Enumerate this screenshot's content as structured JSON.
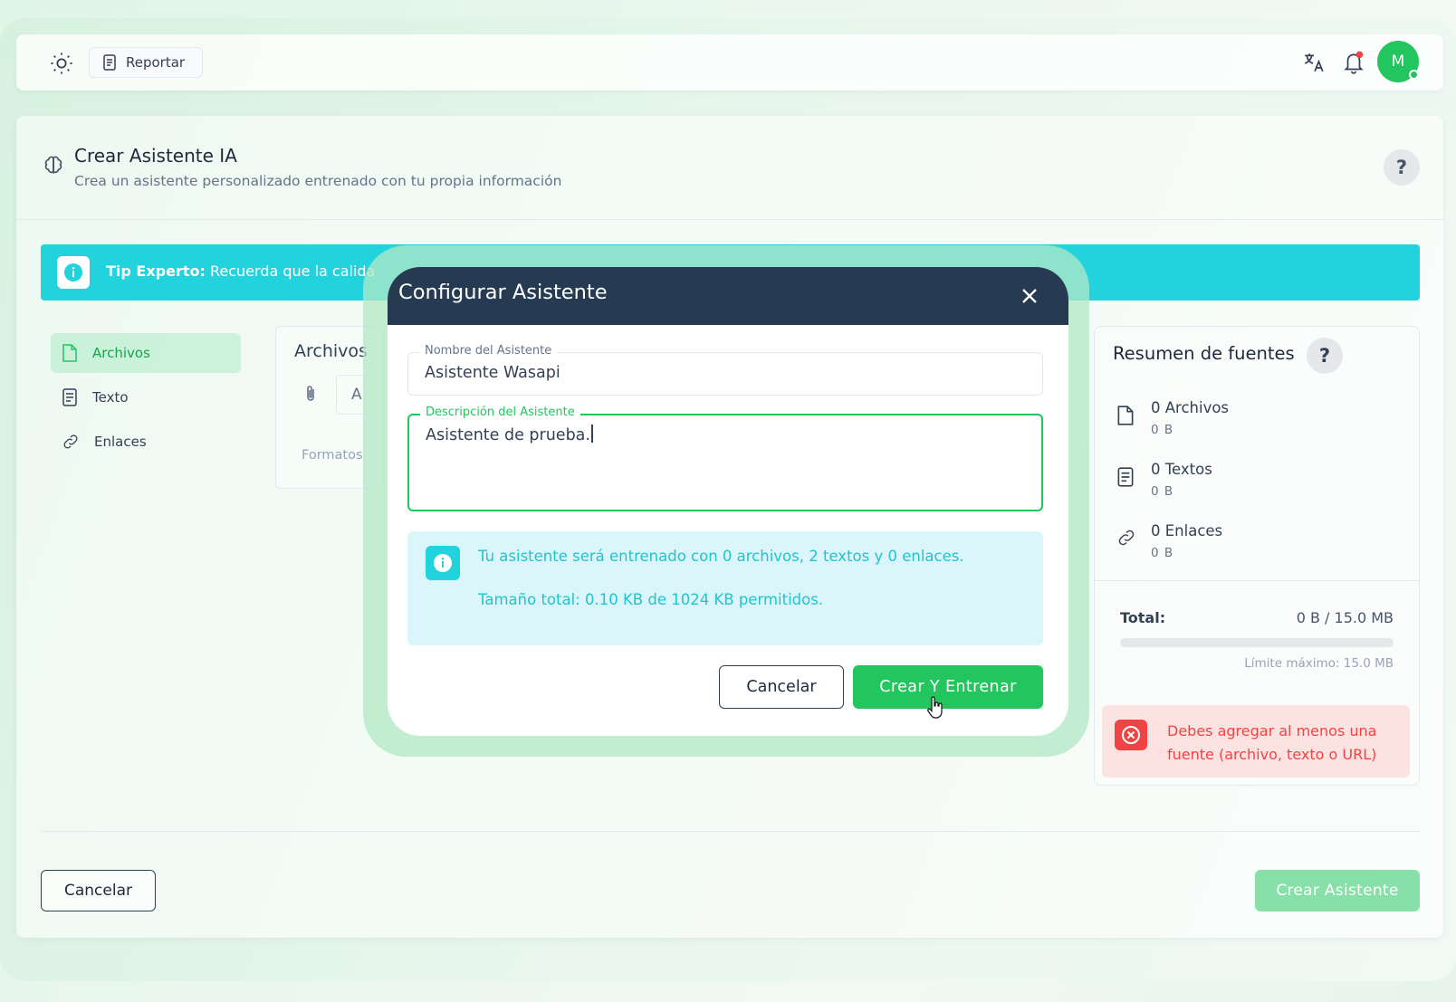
{
  "topbar": {
    "report_label": "Reportar",
    "avatar_initial": "M"
  },
  "page": {
    "title": "Crear Asistente IA",
    "subtitle": "Crea un asistente personalizado entrenado con tu propia información",
    "help_label": "?"
  },
  "tip": {
    "prefix": "Tip Experto:",
    "text": "Recuerda que la calida"
  },
  "sidebar": {
    "items": [
      {
        "label": "Archivos",
        "active": true
      },
      {
        "label": "Texto",
        "active": false
      },
      {
        "label": "Enlaces",
        "active": false
      }
    ]
  },
  "files_panel": {
    "title": "Archivos",
    "input_text": "A",
    "formats_text": "Formatos"
  },
  "summary": {
    "title": "Resumen de fuentes",
    "help_label": "?",
    "sources": [
      {
        "label": "0 Archivos",
        "size": "0 B",
        "icon": "file-icon"
      },
      {
        "label": "0 Textos",
        "size": "0 B",
        "icon": "text-doc-icon"
      },
      {
        "label": "0 Enlaces",
        "size": "0 B",
        "icon": "link-icon"
      }
    ],
    "total_label": "Total:",
    "total_value": "0 B / 15.0 MB",
    "progress_fraction": 0,
    "limit_text": "Límite máximo: 15.0 MB",
    "error_text": "Debes agregar al menos una fuente (archivo, texto o URL)"
  },
  "footer": {
    "cancel_label": "Cancelar",
    "create_label": "Crear Asistente"
  },
  "modal": {
    "title": "Configurar Asistente",
    "name_label": "Nombre del Asistente",
    "name_value": "Asistente Wasapi",
    "description_label": "Descripción del Asistente",
    "description_value": "Asistente de prueba.",
    "info_line1": "Tu asistente será entrenado con 0 archivos, 2 textos y 0 enlaces.",
    "info_line2": "Tamaño total: 0.10 KB de 1024 KB permitidos.",
    "cancel_label": "Cancelar",
    "create_label": "Crear Y Entrenar"
  },
  "colors": {
    "primary_green": "#22c55e",
    "header_navy": "#263a52",
    "info_cyan": "#22d3dd",
    "error_red": "#ef4444"
  }
}
